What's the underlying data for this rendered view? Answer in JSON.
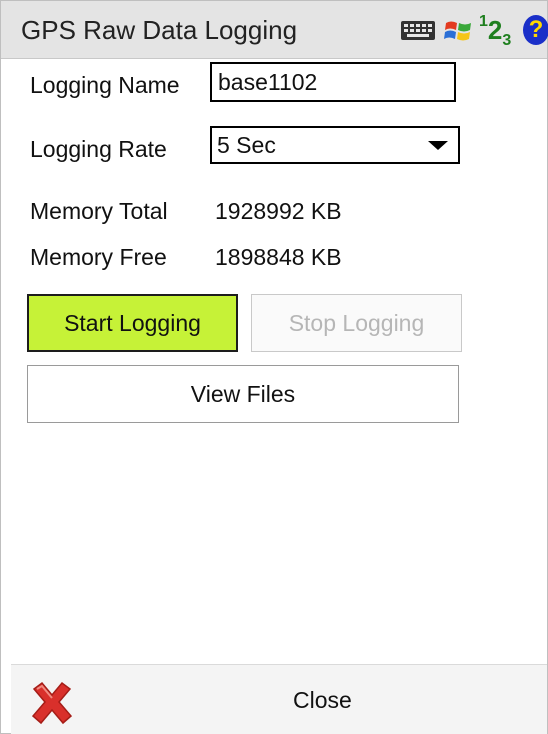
{
  "window": {
    "title": "GPS Raw Data Logging"
  },
  "tray": {
    "icons": [
      "keyboard-icon",
      "windows-flag-icon",
      "input-mode-123-icon",
      "help-icon"
    ],
    "input_mode": "123",
    "help_symbol": "?"
  },
  "form": {
    "logging_name_label": "Logging Name",
    "logging_name_value": "base1102",
    "logging_rate_label": "Logging Rate",
    "logging_rate_value": "5 Sec",
    "memory_total_label": "Memory Total",
    "memory_total_value": "1928992 KB",
    "memory_free_label": "Memory Free",
    "memory_free_value": "1898848 KB"
  },
  "buttons": {
    "start_label": "Start Logging",
    "stop_label": "Stop Logging",
    "view_files_label": "View Files"
  },
  "bottom_bar": {
    "close_label": "Close"
  },
  "colors": {
    "start_button_bg": "#c6f237",
    "title_bar_bg": "#e4e4e4",
    "disabled_text": "#b6b6b6",
    "close_icon_red": "#d9302b"
  }
}
